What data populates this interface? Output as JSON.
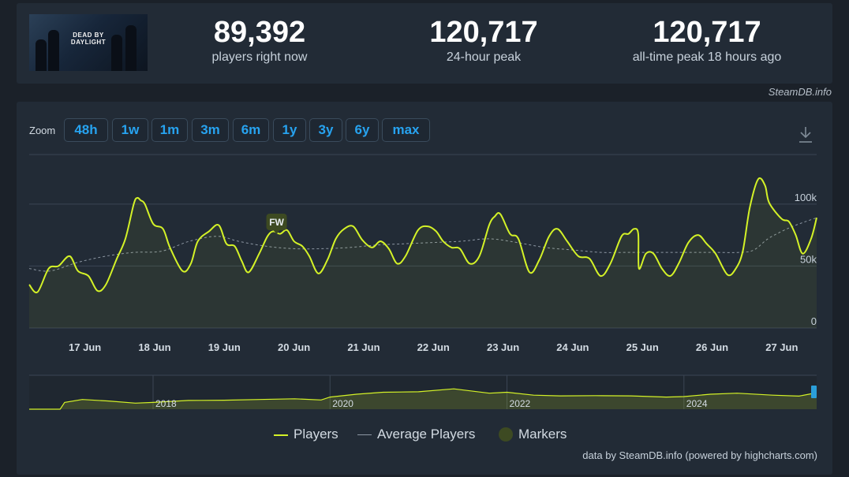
{
  "header": {
    "game_logo_text": "DEAD BY DAYLIGHT",
    "stats": [
      {
        "value": "89,392",
        "label": "players right now"
      },
      {
        "value": "120,717",
        "label": "24-hour peak"
      },
      {
        "value": "120,717",
        "label": "all-time peak 18 hours ago"
      }
    ],
    "credit": "SteamDB.info"
  },
  "toolbar": {
    "zoom_label": "Zoom",
    "zoom_buttons": [
      "48h",
      "1w",
      "1m",
      "3m",
      "6m",
      "1y",
      "3y",
      "6y",
      "max"
    ]
  },
  "legend": {
    "players": "Players",
    "average": "Average Players",
    "markers": "Markers"
  },
  "footer_credit": "data by SteamDB.info (powered by highcharts.com)",
  "colors": {
    "players": "#d4f227",
    "average": "#8d97a3",
    "marker": "#3d4a22"
  },
  "chart_data": {
    "type": "line",
    "x_unit": "days from 16 Jun 2025 00:00",
    "xlim": [
      16.2,
      27.5
    ],
    "ylim": [
      0,
      140000
    ],
    "yticks": [
      {
        "v": 0,
        "label": "0"
      },
      {
        "v": 50000,
        "label": "50k"
      },
      {
        "v": 100000,
        "label": "100k"
      }
    ],
    "xticks": [
      {
        "v": 17,
        "label": "17 Jun"
      },
      {
        "v": 18,
        "label": "18 Jun"
      },
      {
        "v": 19,
        "label": "19 Jun"
      },
      {
        "v": 20,
        "label": "20 Jun"
      },
      {
        "v": 21,
        "label": "21 Jun"
      },
      {
        "v": 22,
        "label": "22 Jun"
      },
      {
        "v": 23,
        "label": "23 Jun"
      },
      {
        "v": 24,
        "label": "24 Jun"
      },
      {
        "v": 25,
        "label": "25 Jun"
      },
      {
        "v": 26,
        "label": "26 Jun"
      },
      {
        "v": 27,
        "label": "27 Jun"
      }
    ],
    "series": [
      {
        "name": "Players",
        "x": [
          16.2,
          16.32,
          16.48,
          16.62,
          16.78,
          16.9,
          17.05,
          17.18,
          17.3,
          17.45,
          17.58,
          17.7,
          17.75,
          17.8,
          17.86,
          17.98,
          18.12,
          18.22,
          18.4,
          18.52,
          18.62,
          18.78,
          18.92,
          19.03,
          19.15,
          19.25,
          19.35,
          19.5,
          19.62,
          19.7,
          19.8,
          19.9,
          20.0,
          20.12,
          20.22,
          20.35,
          20.48,
          20.6,
          20.72,
          20.85,
          20.98,
          21.12,
          21.24,
          21.36,
          21.48,
          21.6,
          21.78,
          21.92,
          22.04,
          22.14,
          22.26,
          22.38,
          22.52,
          22.66,
          22.8,
          22.88,
          22.96,
          23.1,
          23.22,
          23.38,
          23.52,
          23.66,
          23.78,
          23.92,
          24.08,
          24.24,
          24.4,
          24.54,
          24.7,
          24.8,
          24.88,
          24.94,
          24.95,
          25.05,
          25.16,
          25.28,
          25.4,
          25.52,
          25.66,
          25.8,
          25.92,
          26.05,
          26.22,
          26.34,
          26.44,
          26.54,
          26.66,
          26.76,
          26.82,
          27.0,
          27.1,
          27.2,
          27.3,
          27.42,
          27.5
        ],
        "values": [
          35000,
          29000,
          48000,
          50000,
          58000,
          46000,
          42000,
          30000,
          35000,
          55000,
          72000,
          100000,
          105000,
          103000,
          100000,
          84000,
          80000,
          65000,
          46000,
          52000,
          70000,
          78000,
          83000,
          68000,
          66000,
          54000,
          45000,
          60000,
          74000,
          78000,
          76000,
          79000,
          70000,
          66000,
          58000,
          44000,
          55000,
          72000,
          80000,
          82000,
          71000,
          65000,
          70000,
          64000,
          52000,
          58000,
          79000,
          82000,
          78000,
          70000,
          65000,
          64000,
          52000,
          58000,
          83000,
          90000,
          92000,
          76000,
          72000,
          45000,
          55000,
          74000,
          80000,
          70000,
          58000,
          56000,
          42000,
          52000,
          74000,
          76000,
          80000,
          76000,
          48000,
          60000,
          60000,
          48000,
          42000,
          52000,
          69000,
          75000,
          68000,
          60000,
          43000,
          48000,
          62000,
          97000,
          120000,
          115000,
          101000,
          88000,
          86000,
          75000,
          60000,
          72000,
          89000
        ]
      },
      {
        "name": "Average Players",
        "x": [
          16.2,
          16.5,
          16.9,
          17.3,
          17.7,
          18.1,
          18.5,
          18.9,
          19.2,
          19.6,
          20.0,
          20.4,
          20.8,
          21.2,
          21.6,
          22.0,
          22.4,
          22.8,
          23.2,
          23.6,
          24.0,
          24.4,
          24.8,
          25.2,
          25.6,
          26.0,
          26.4,
          26.6,
          26.8,
          27.0,
          27.2,
          27.5
        ],
        "values": [
          48000,
          46000,
          53000,
          58000,
          61000,
          62000,
          70000,
          74000,
          70000,
          66000,
          64000,
          64000,
          65000,
          67000,
          68000,
          69000,
          70000,
          72000,
          69000,
          65000,
          63000,
          61000,
          61000,
          61000,
          61000,
          61000,
          61000,
          63000,
          72000,
          78000,
          83000,
          89000
        ]
      }
    ],
    "markers": [
      {
        "x": 19.75,
        "label": "FW"
      }
    ],
    "navigator": {
      "xticks": [
        {
          "v": 2018,
          "label": "2018"
        },
        {
          "v": 2020,
          "label": "2020"
        },
        {
          "v": 2022,
          "label": "2022"
        },
        {
          "v": 2024,
          "label": "2024"
        }
      ],
      "xlim": [
        2016.6,
        2025.5
      ],
      "ylim": [
        0,
        140000
      ],
      "x": [
        2016.6,
        2016.95,
        2017.0,
        2017.2,
        2017.5,
        2017.8,
        2018.0,
        2018.4,
        2018.8,
        2019.2,
        2019.6,
        2019.9,
        2020.0,
        2020.3,
        2020.6,
        2021.0,
        2021.4,
        2021.8,
        2022.0,
        2022.3,
        2022.6,
        2023.0,
        2023.4,
        2023.8,
        2024.0,
        2024.3,
        2024.6,
        2025.0,
        2025.3,
        2025.5
      ],
      "values": [
        0,
        0,
        28000,
        40000,
        34000,
        25000,
        28000,
        36000,
        37000,
        40000,
        43000,
        38000,
        50000,
        62000,
        70000,
        72000,
        84000,
        66000,
        70000,
        58000,
        55000,
        56000,
        55000,
        50000,
        52000,
        62000,
        66000,
        58000,
        54000,
        68000
      ]
    }
  }
}
